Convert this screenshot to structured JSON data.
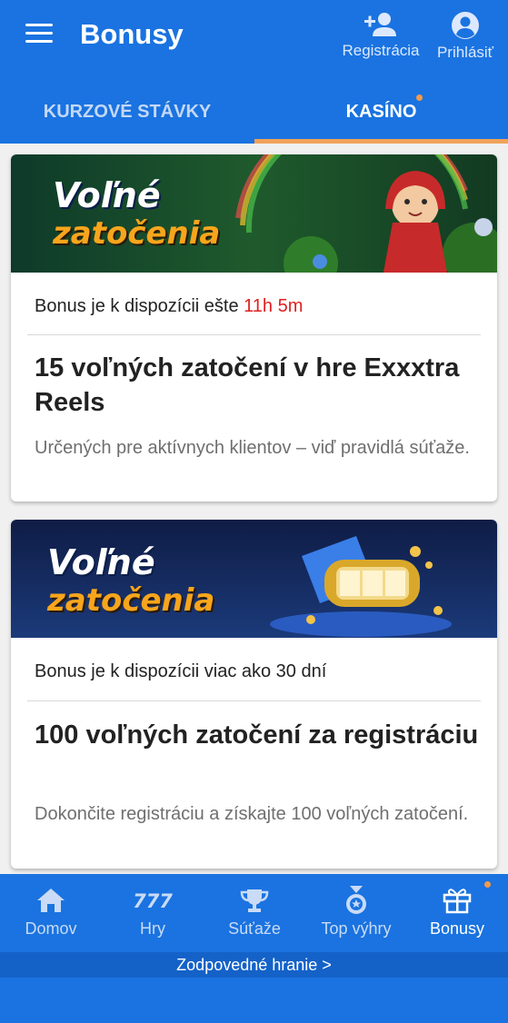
{
  "header": {
    "title": "Bonusy",
    "register_label": "Registrácia",
    "login_label": "Prihlásiť"
  },
  "tabs": [
    {
      "label": "KURZOVÉ STÁVKY",
      "active": false
    },
    {
      "label": "KASÍNO",
      "active": true,
      "has_dot": true
    }
  ],
  "bonuses": [
    {
      "banner_line1": "Voľné",
      "banner_line2": "zatočenia",
      "availability_prefix": "Bonus je k dispozícii ešte ",
      "availability_time": "11h 5m",
      "title": "15 voľných zatočení v hre Exxxtra Reels",
      "description": "Určených pre aktívnych klientov – viď pravidlá súťaže."
    },
    {
      "banner_line1": "Voľné",
      "banner_line2": "zatočenia",
      "availability_prefix": "Bonus je k dispozícii viac ako 30 dní",
      "availability_time": "",
      "title": "100 voľných zatočení za registráciu",
      "description": "Dokončite registráciu a získajte 100 voľných zatočení."
    }
  ],
  "bottom_nav": [
    {
      "label": "Domov",
      "icon": "home-icon",
      "active": false
    },
    {
      "label": "Hry",
      "icon": "777",
      "active": false
    },
    {
      "label": "Súťaže",
      "icon": "trophy-icon",
      "active": false
    },
    {
      "label": "Top výhry",
      "icon": "medal-icon",
      "active": false
    },
    {
      "label": "Bonusy",
      "icon": "gift-icon",
      "active": true,
      "has_dot": true
    }
  ],
  "footer": {
    "responsible_label": "Zodpovedné hranie >"
  },
  "colors": {
    "brand_blue": "#1a73e0",
    "accent_orange": "#f0a35a",
    "time_red": "#e02020"
  }
}
